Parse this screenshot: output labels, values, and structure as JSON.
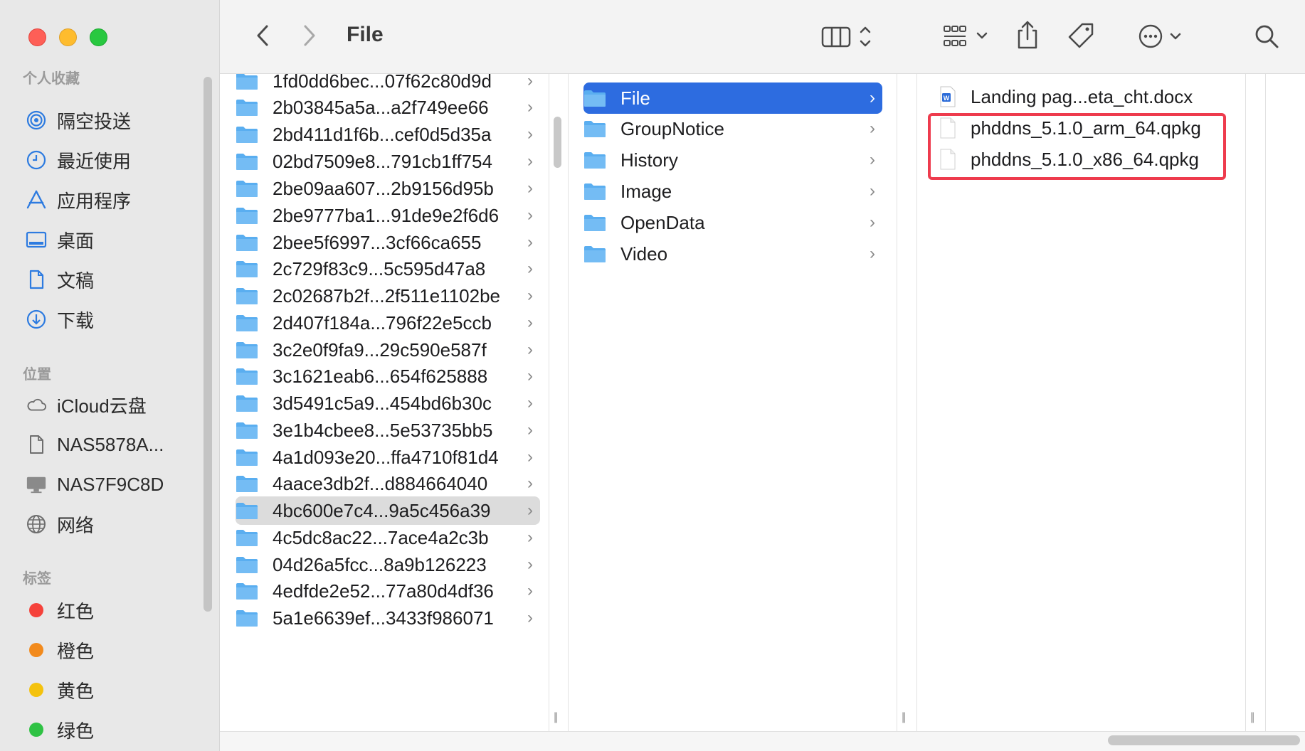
{
  "window": {
    "title": "File"
  },
  "sidebar": {
    "favorites_header": "个人收藏",
    "favorites": [
      {
        "label": "隔空投送",
        "icon": "airdrop-icon"
      },
      {
        "label": "最近使用",
        "icon": "clock-icon"
      },
      {
        "label": "应用程序",
        "icon": "applications-icon"
      },
      {
        "label": "桌面",
        "icon": "desktop-icon"
      },
      {
        "label": "文稿",
        "icon": "document-icon"
      },
      {
        "label": "下载",
        "icon": "download-icon"
      }
    ],
    "locations_header": "位置",
    "locations": [
      {
        "label": "iCloud云盘",
        "icon": "icloud-icon"
      },
      {
        "label": "NAS5878A...",
        "icon": "file-icon"
      },
      {
        "label": "NAS7F9C8D",
        "icon": "monitor-icon"
      },
      {
        "label": "网络",
        "icon": "globe-icon"
      }
    ],
    "tags_header": "标签",
    "tags": [
      {
        "label": "红色",
        "color": "#f5423b"
      },
      {
        "label": "橙色",
        "color": "#f28a1c"
      },
      {
        "label": "黄色",
        "color": "#f4c20d"
      },
      {
        "label": "绿色",
        "color": "#2fc244"
      }
    ]
  },
  "toolbar": {
    "back_icon": "chevron-left-icon",
    "forward_icon": "chevron-right-icon",
    "view_icon": "column-view-icon",
    "group_icon": "grid-group-icon",
    "share_icon": "share-icon",
    "tag_icon": "tag-icon",
    "more_icon": "ellipsis-circle-icon",
    "search_icon": "search-icon"
  },
  "column1": {
    "items": [
      "1fd0dd6bec...07f62c80d9d",
      "2b03845a5a...a2f749ee66",
      "2bd411d1f6b...cef0d5d35a",
      "02bd7509e8...791cb1ff754",
      "2be09aa607...2b9156d95b",
      "2be9777ba1...91de9e2f6d6",
      "2bee5f6997...3cf66ca655",
      "2c729f83c9...5c595d47a8",
      "2c02687b2f...2f511e1102be",
      "2d407f184a...796f22e5ccb",
      "3c2e0f9fa9...29c590e587f",
      "3c1621eab6...654f625888",
      "3d5491c5a9...454bd6b30c",
      "3e1b4cbee8...5e53735bb5",
      "4a1d093e20...ffa4710f81d4",
      "4aace3db2f...d884664040",
      "4bc600e7c4...9a5c456a39",
      "4c5dc8ac22...7ace4a2c3b",
      "04d26a5fcc...8a9b126223",
      "4edfde2e52...77a80d4df36",
      "5a1e6639ef...3433f986071"
    ],
    "selected_index": 16
  },
  "column2": {
    "items": [
      "File",
      "GroupNotice",
      "History",
      "Image",
      "OpenData",
      "Video"
    ],
    "selected_index": 0
  },
  "column3": {
    "items": [
      {
        "label": "Landing pag...eta_cht.docx",
        "type": "docx"
      },
      {
        "label": "phddns_5.1.0_arm_64.qpkg",
        "type": "file"
      },
      {
        "label": "phddns_5.1.0_x86_64.qpkg",
        "type": "file"
      }
    ]
  },
  "colors": {
    "selection_blue": "#2d6ce0",
    "highlight_red": "#ee3b4d",
    "folder_blue": "#5aaef0"
  }
}
